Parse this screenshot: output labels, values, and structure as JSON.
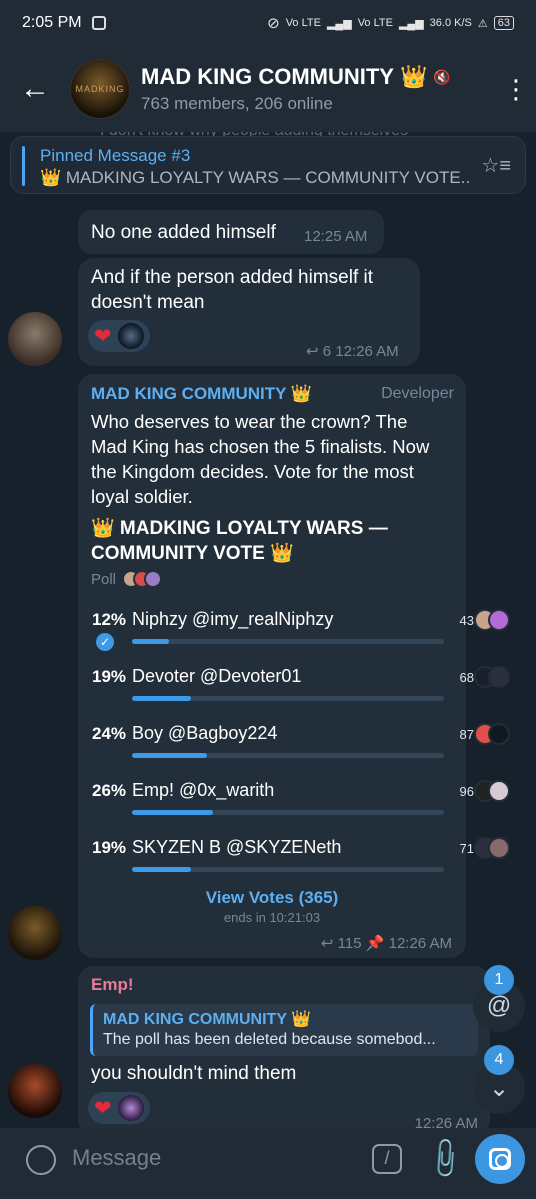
{
  "status_bar": {
    "time": "2:05 PM",
    "network_left": "Vo LTE",
    "network_right": "Vo LTE",
    "speed": "36.0 K/S",
    "battery": "63"
  },
  "header": {
    "title": "MAD KING COMMUNITY",
    "title_emoji": "👑",
    "subtitle": "763 members, 206 online",
    "avatar_label": "MADKING"
  },
  "ghost_text": "I don't know why people adding themselves",
  "pinned": {
    "title": "Pinned Message #3",
    "text": "👑 MADKING LOYALTY WARS — COMMUNITY VOTE..."
  },
  "msg1": {
    "text": "No one added himself",
    "time": "12:25 AM"
  },
  "msg2": {
    "text": "And if the person added himself it doesn't mean",
    "replies": "6",
    "time": "12:26 AM"
  },
  "poll_post": {
    "sender": "MAD KING COMMUNITY 👑",
    "role": "Developer",
    "body": "Who deserves to wear the crown? The Mad King has chosen the 5 finalists. Now the Kingdom decides. Vote for the most loyal soldier.",
    "question": "👑 MADKING LOYALTY WARS — COMMUNITY VOTE 👑",
    "poll_label": "Poll",
    "options": [
      {
        "pct": "12%",
        "name": "Niphzy @imy_realNiphzy",
        "count": "43",
        "fill": 0.12,
        "checked": true
      },
      {
        "pct": "19%",
        "name": "Devoter @Devoter01",
        "count": "68",
        "fill": 0.19
      },
      {
        "pct": "24%",
        "name": "Boy @Bagboy224",
        "count": "87",
        "fill": 0.24
      },
      {
        "pct": "26%",
        "name": "Emp! @0x_warith",
        "count": "96",
        "fill": 0.26
      },
      {
        "pct": "19%",
        "name": "SKYZEN B @SKYZENeth",
        "count": "71",
        "fill": 0.19
      }
    ],
    "view_votes": "View Votes (365)",
    "ends": "ends in 10:21:03",
    "replies": "115",
    "time": "12:26 AM"
  },
  "msg3": {
    "sender": "Emp!",
    "quote_sender": "MAD KING COMMUNITY 👑",
    "quote_text": "The poll has been deleted because somebod...",
    "text": "you shouldn't mind them",
    "time": "12:26 AM"
  },
  "fabs": {
    "mention_badge": "1",
    "down_badge": "4"
  },
  "composer": {
    "placeholder": "Message"
  },
  "colors": {
    "accent": "#3d96e0",
    "sender_blue": "#5eaff2",
    "sender_pink": "#e87b9a",
    "bubble": "#222e3a"
  }
}
